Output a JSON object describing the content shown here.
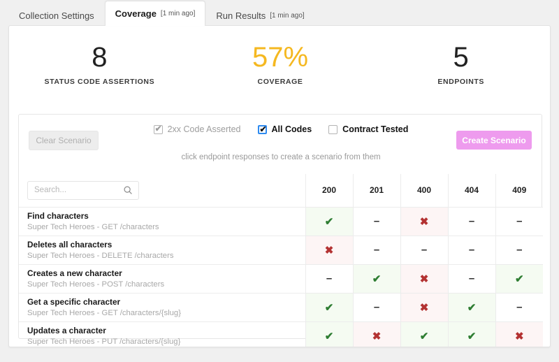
{
  "tabs": [
    {
      "label": "Collection Settings",
      "timestamp": "",
      "active": false
    },
    {
      "label": "Coverage",
      "timestamp": "[1 min ago]",
      "active": true
    },
    {
      "label": "Run Results",
      "timestamp": "[1 min ago]",
      "active": false
    }
  ],
  "stats": [
    {
      "value": "8",
      "label": "STATUS CODE ASSERTIONS"
    },
    {
      "value": "57%",
      "label": "COVERAGE"
    },
    {
      "value": "5",
      "label": "ENDPOINTS"
    }
  ],
  "controls": {
    "clear_label": "Clear Scenario",
    "create_label": "Create Scenario",
    "hint": "click endpoint responses to create a scenario from them",
    "checkboxes": [
      {
        "label": "2xx Code Asserted",
        "checked": true,
        "state": "disabled",
        "glyph": "✔"
      },
      {
        "label": "All Codes",
        "checked": true,
        "state": "enabled",
        "glyph": "✔"
      },
      {
        "label": "Contract Tested",
        "checked": false,
        "state": "off",
        "glyph": ""
      }
    ]
  },
  "search": {
    "value": "",
    "placeholder": "Search...",
    "icon": "search-icon"
  },
  "table": {
    "columns": [
      "200",
      "201",
      "400",
      "404",
      "409"
    ],
    "rows": [
      {
        "name": "Find characters",
        "desc": "Super Tech Heroes - GET /characters",
        "cells": [
          {
            "status": "pass",
            "glyph": "✔"
          },
          {
            "status": "none",
            "glyph": "–"
          },
          {
            "status": "fail",
            "glyph": "✖"
          },
          {
            "status": "none",
            "glyph": "–"
          },
          {
            "status": "none",
            "glyph": "–"
          }
        ]
      },
      {
        "name": "Deletes all characters",
        "desc": "Super Tech Heroes - DELETE /characters",
        "cells": [
          {
            "status": "fail",
            "glyph": "✖"
          },
          {
            "status": "none",
            "glyph": "–"
          },
          {
            "status": "none",
            "glyph": "–"
          },
          {
            "status": "none",
            "glyph": "–"
          },
          {
            "status": "none",
            "glyph": "–"
          }
        ]
      },
      {
        "name": "Creates a new character",
        "desc": "Super Tech Heroes - POST /characters",
        "cells": [
          {
            "status": "none",
            "glyph": "–"
          },
          {
            "status": "pass",
            "glyph": "✔"
          },
          {
            "status": "fail",
            "glyph": "✖"
          },
          {
            "status": "none",
            "glyph": "–"
          },
          {
            "status": "pass",
            "glyph": "✔"
          }
        ]
      },
      {
        "name": "Get a specific character",
        "desc": "Super Tech Heroes - GET /characters/{slug}",
        "cells": [
          {
            "status": "pass",
            "glyph": "✔"
          },
          {
            "status": "none",
            "glyph": "–"
          },
          {
            "status": "fail",
            "glyph": "✖"
          },
          {
            "status": "pass",
            "glyph": "✔"
          },
          {
            "status": "none",
            "glyph": "–"
          }
        ]
      },
      {
        "name": "Updates a character",
        "desc": "Super Tech Heroes - PUT /characters/{slug}",
        "cells": [
          {
            "status": "pass",
            "glyph": "✔"
          },
          {
            "status": "fail",
            "glyph": "✖"
          },
          {
            "status": "pass",
            "glyph": "✔"
          },
          {
            "status": "pass",
            "glyph": "✔"
          },
          {
            "status": "fail",
            "glyph": "✖"
          }
        ]
      }
    ]
  },
  "colors": {
    "coverage_accent": "#f5b820",
    "create_button": "#ee9bee",
    "pass": "#2e7d32",
    "fail": "#b33232",
    "pass_bg": "#f5fbf2",
    "fail_bg": "#fdf5f5",
    "focus_outline": "#2f8bf0"
  }
}
